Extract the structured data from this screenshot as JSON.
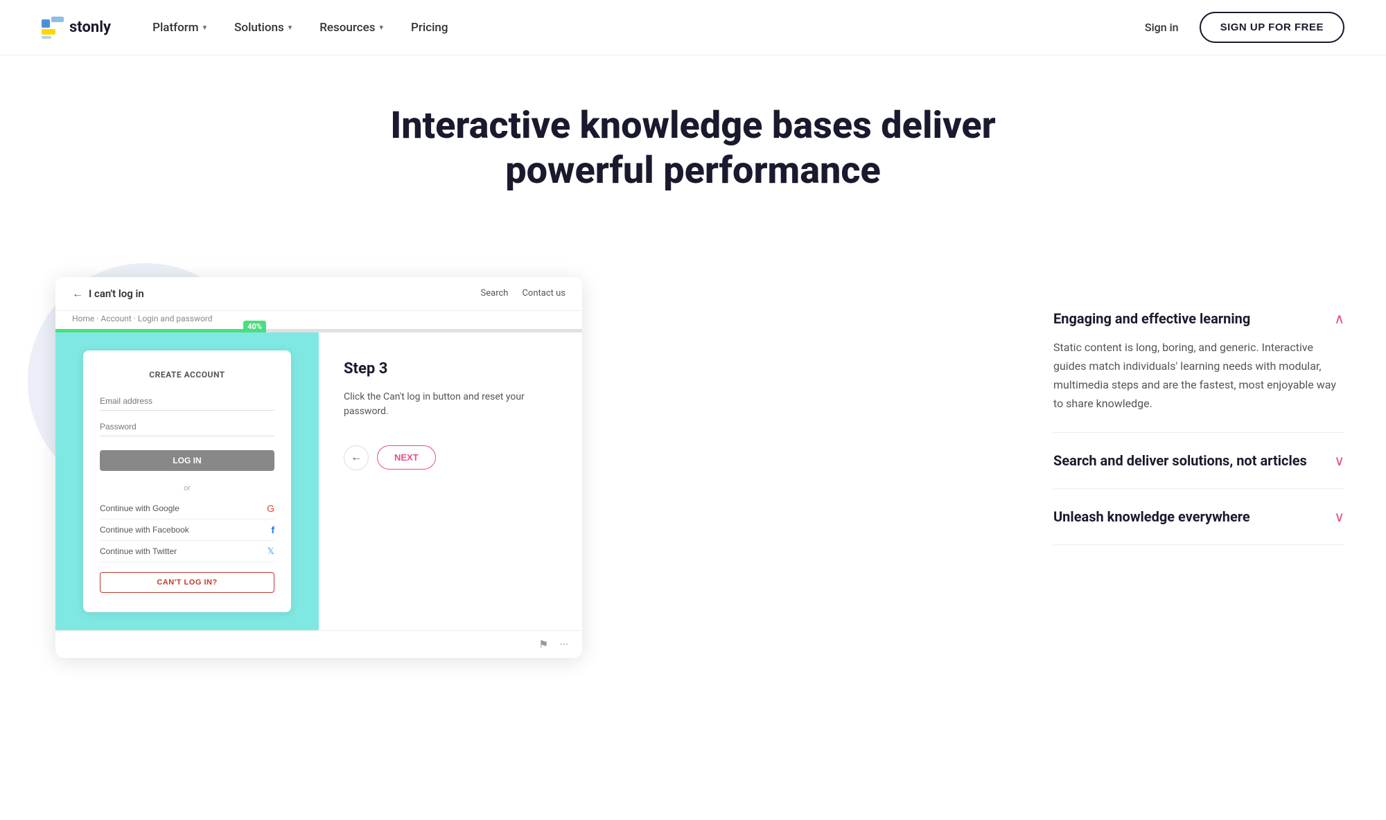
{
  "nav": {
    "logo_text": "stonly",
    "links": [
      {
        "label": "Platform",
        "has_dropdown": true
      },
      {
        "label": "Solutions",
        "has_dropdown": true
      },
      {
        "label": "Resources",
        "has_dropdown": true
      },
      {
        "label": "Pricing",
        "has_dropdown": false
      }
    ],
    "sign_in_label": "Sign in",
    "sign_up_label": "SIGN UP FOR FREE"
  },
  "hero": {
    "title": "Interactive knowledge bases deliver powerful performance"
  },
  "demo": {
    "back_arrow": "←",
    "topbar_title": "I can't log in",
    "breadcrumb": "Home · Account · Login and password",
    "search_label": "Search",
    "contact_label": "Contact us",
    "progress_percent": "40%",
    "left_panel": {
      "create_account_label": "CREATE ACCOUNT",
      "email_placeholder": "Email address",
      "password_placeholder": "Password",
      "login_btn_label": "LOG IN",
      "or_label": "or",
      "social_btns": [
        {
          "label": "Continue with Google",
          "color": "#ea4335"
        },
        {
          "label": "Continue with Facebook",
          "color": "#1877f2"
        },
        {
          "label": "Continue with Twitter",
          "color": "#1da1f2"
        }
      ],
      "cant_login_label": "CAN'T LOG IN?"
    },
    "right_panel": {
      "step_label": "Step 3",
      "step_desc": "Click the Can't log in button and reset your password.",
      "back_arrow": "←",
      "next_label": "NEXT"
    },
    "bottom_icons": [
      "⚑",
      "···"
    ]
  },
  "features": [
    {
      "id": "engaging",
      "title": "Engaging and effective learning",
      "expanded": true,
      "chevron": "∧",
      "desc": "Static content is long, boring, and generic. Interactive guides match individuals' learning needs with modular, multimedia steps and are the fastest, most enjoyable way to share knowledge."
    },
    {
      "id": "search",
      "title": "Search and deliver solutions, not articles",
      "expanded": false,
      "chevron": "∨",
      "desc": ""
    },
    {
      "id": "unleash",
      "title": "Unleash knowledge everywhere",
      "expanded": false,
      "chevron": "∨",
      "desc": ""
    }
  ]
}
